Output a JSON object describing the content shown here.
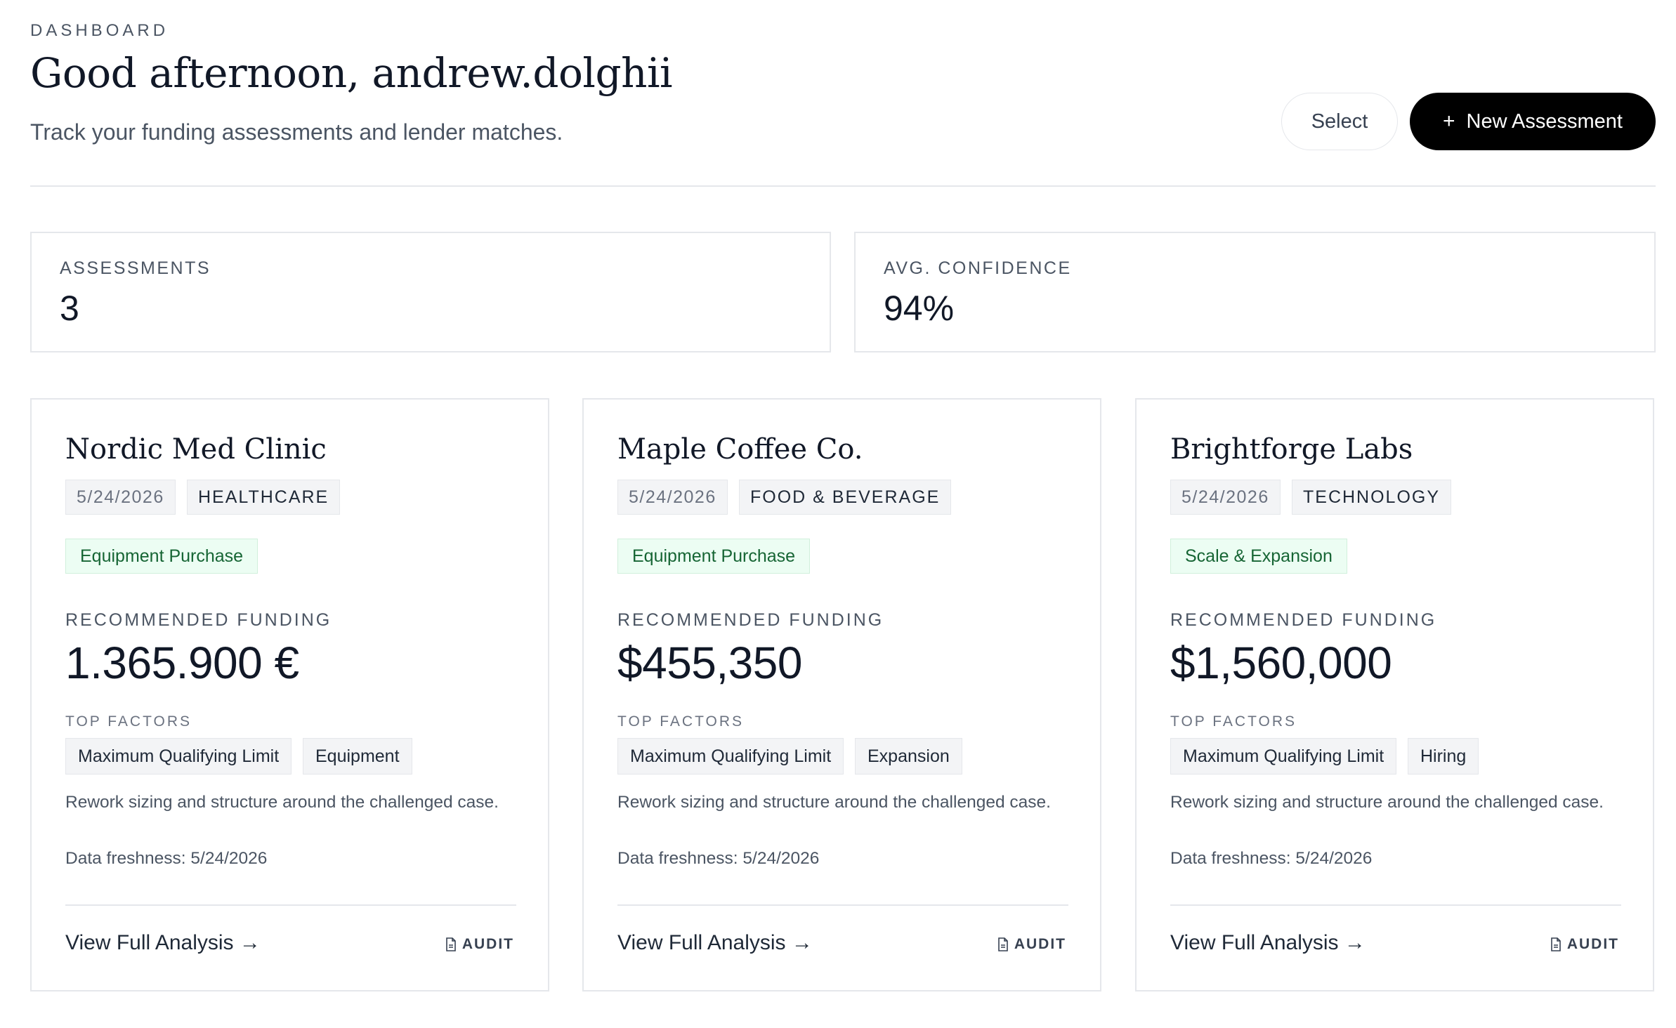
{
  "header": {
    "eyebrow": "DASHBOARD",
    "greeting": "Good afternoon, andrew.dolghii",
    "subtitle": "Track your funding assessments and lender matches.",
    "select_label": "Select",
    "new_plus": "+",
    "new_label": "New Assessment"
  },
  "stats": [
    {
      "label": "ASSESSMENTS",
      "value": "3"
    },
    {
      "label": "AVG. CONFIDENCE",
      "value": "94%"
    }
  ],
  "cards": [
    {
      "name": "Nordic Med Clinic",
      "date": "5/24/2026",
      "industry": "HEALTHCARE",
      "purpose": "Equipment Purchase",
      "rec_label": "RECOMMENDED FUNDING",
      "amount": "1.365.900 €",
      "tf_label": "TOP FACTORS",
      "factors": [
        "Maximum Qualifying Limit",
        "Equipment"
      ],
      "description": "Rework sizing and structure around the challenged case.",
      "freshness": "Data freshness: 5/24/2026",
      "view_label": "View Full Analysis →",
      "audit_label": "AUDIT"
    },
    {
      "name": "Maple Coffee Co.",
      "date": "5/24/2026",
      "industry": "FOOD & BEVERAGE",
      "purpose": "Equipment Purchase",
      "rec_label": "RECOMMENDED FUNDING",
      "amount": "$455,350",
      "tf_label": "TOP FACTORS",
      "factors": [
        "Maximum Qualifying Limit",
        "Expansion"
      ],
      "description": "Rework sizing and structure around the challenged case.",
      "freshness": "Data freshness: 5/24/2026",
      "view_label": "View Full Analysis →",
      "audit_label": "AUDIT"
    },
    {
      "name": "Brightforge Labs",
      "date": "5/24/2026",
      "industry": "TECHNOLOGY",
      "purpose": "Scale & Expansion",
      "rec_label": "RECOMMENDED FUNDING",
      "amount": "$1,560,000",
      "tf_label": "TOP FACTORS",
      "factors": [
        "Maximum Qualifying Limit",
        "Hiring"
      ],
      "description": "Rework sizing and structure around the challenged case.",
      "freshness": "Data freshness: 5/24/2026",
      "view_label": "View Full Analysis →",
      "audit_label": "AUDIT"
    }
  ],
  "icons": {
    "audit": "document-icon"
  },
  "colors": {
    "accent": "#000000",
    "purpose_bg": "#ecfdf3",
    "purpose_text": "#166534"
  }
}
